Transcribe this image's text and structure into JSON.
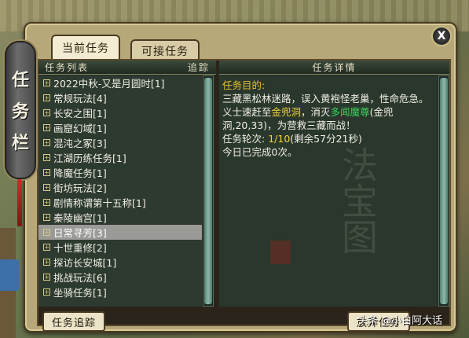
{
  "tabs": {
    "current": "当前任务",
    "available": "可接任务"
  },
  "close_label": "X",
  "emblem": [
    "任",
    "务",
    "栏"
  ],
  "list": {
    "header_title": "任务列表",
    "header_track": "追踪",
    "items": [
      "2022中秋-又是月圆时[1]",
      "常规玩法[4]",
      "长安之围[1]",
      "画窟幻域[1]",
      "混沌之冢[3]",
      "江湖历练任务[1]",
      "降魔任务[1]",
      "街坊玩法[2]",
      "剧情称谓第十五称[1]",
      "秦陵幽宫[1]",
      "日常寻芳[3]",
      "十世重修[2]",
      "探访长安城[1]",
      "挑战玩法[6]",
      "坐骑任务[1]"
    ],
    "selected_index": 10
  },
  "detail": {
    "header_title": "任务详情",
    "goal_label": "任务目的:",
    "desc_part1": "三藏黑松林迷路，误入黄袍怪老巢，性命危急。义士速赶至",
    "location": "金兜洞",
    "desc_part2": "，消灭",
    "target": "多闻魔尊",
    "coords": "(金兜洞,20,33)",
    "desc_part3": "，为营救三藏而战！",
    "round_label": "任务轮次:",
    "round_value": "1/10",
    "remaining": "(剩余57分21秒)",
    "completed": "今日已完成0次。",
    "bg_calligraphy": "法宝图"
  },
  "buttons": {
    "track": "任务追踪",
    "accept": "放弃任务"
  },
  "watermark": "头条 @小白阿大话",
  "colors": {
    "goal": "#e8c22e",
    "location": "#f0d23a",
    "target": "#3ad35a",
    "selected_row": "#9a9a96"
  }
}
